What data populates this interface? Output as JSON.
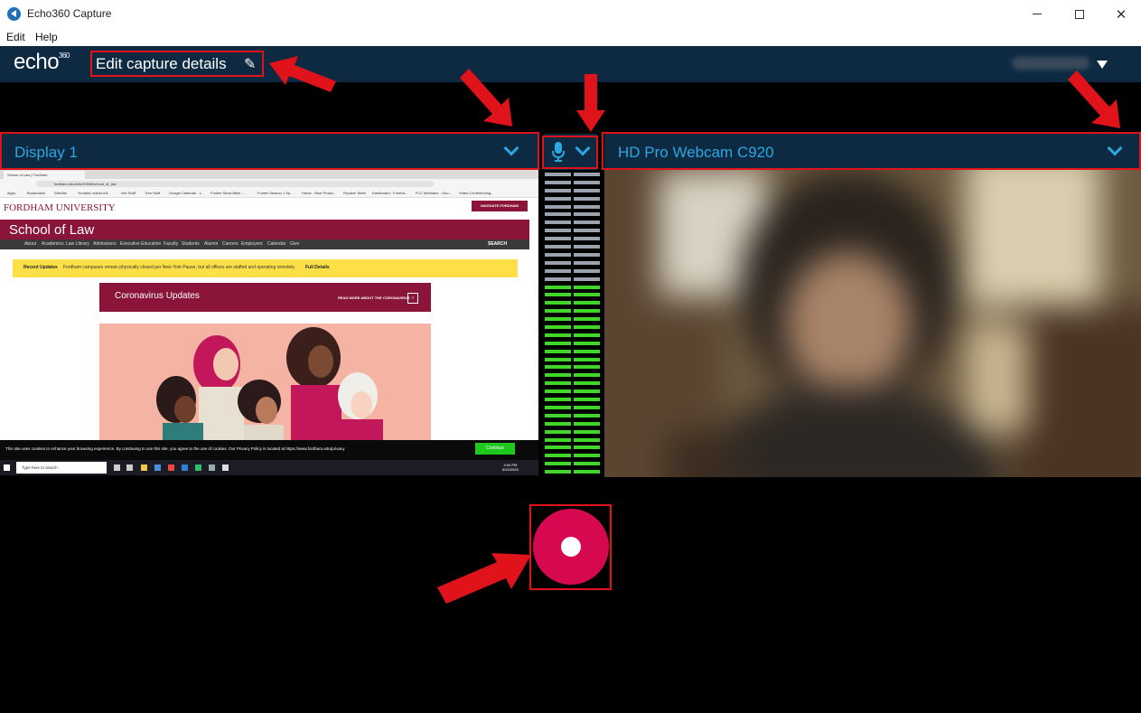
{
  "window": {
    "title": "Echo360 Capture",
    "minimize_icon": "minimize-icon",
    "maximize_icon": "maximize-icon",
    "close_icon": "close-icon",
    "close_glyph": "✕"
  },
  "menu": {
    "items": [
      "Edit",
      "Help"
    ]
  },
  "header": {
    "logo": "echo",
    "logo_sup": "360",
    "edit_details_label": "Edit capture details",
    "pencil_glyph": "✎",
    "user_menu_icon": "caret-down-icon"
  },
  "sources": {
    "display": {
      "label": "Display 1",
      "dropdown_icon": "chevron-down-icon"
    },
    "audio": {
      "icon": "microphone-icon",
      "dropdown_icon": "chevron-down-icon"
    },
    "camera": {
      "label": "HD Pro Webcam C920",
      "dropdown_icon": "chevron-down-icon"
    }
  },
  "display_preview": {
    "tab_title": "School of Law | Fordham",
    "address": "fordham.edu/info/20546/school_of_law",
    "bookmarks": [
      "Apps",
      "Bookmarks",
      "Wishlist",
      "Youtube videos full...",
      "Info Stuff",
      "Trim Stuff",
      "Google Calendar - L...",
      "Funtes Show Bible -...",
      "Funtes Season 1 Sp...",
      "Home - Blue Protoc...",
      "Rooster Teeth",
      "Dashboard - Fordha...",
      "FLC Webinars - Goo...",
      "Video Conferencing..."
    ],
    "university": "FORDHAM UNIVERSITY",
    "navigate_button": "NAVIGATE FORDHAM",
    "school_title": "School of Law",
    "nav_links": [
      "About",
      "Academics",
      "Law Library",
      "Admissions",
      "Executive Education",
      "Faculty",
      "Students",
      "Alumni",
      "Careers",
      "Employers",
      "Calendar",
      "Give"
    ],
    "search_label": "SEARCH",
    "recent_updates_label": "Recent Updates",
    "recent_updates_text": "Fordham campuses remain physically closed per New York Pause, but all offices are staffed and operating remotely.",
    "full_details": "Full Details",
    "covid_title": "Coronavirus Updates",
    "covid_more": "READ MORE ABOUT THE CORONAVIRUS",
    "cookie_text": "This site uses cookies to enhance your browsing experience. By continuing to use this site, you agree to the use of cookies. Our Privacy Policy is located at https://www.fordham.edu/privacy",
    "cookie_button": "Continue",
    "taskbar_search": "Type here to search",
    "clock_time": "4:00 PM",
    "clock_date": "6/23/2020"
  },
  "audio_meter": {
    "segments": 38,
    "active_segments": 24,
    "active_color": "#43d62a",
    "inactive_color": "#9aa3ad"
  },
  "record": {
    "icon": "record-icon",
    "color": "#d6084f"
  },
  "annotations": {
    "color": "#e0121a"
  }
}
